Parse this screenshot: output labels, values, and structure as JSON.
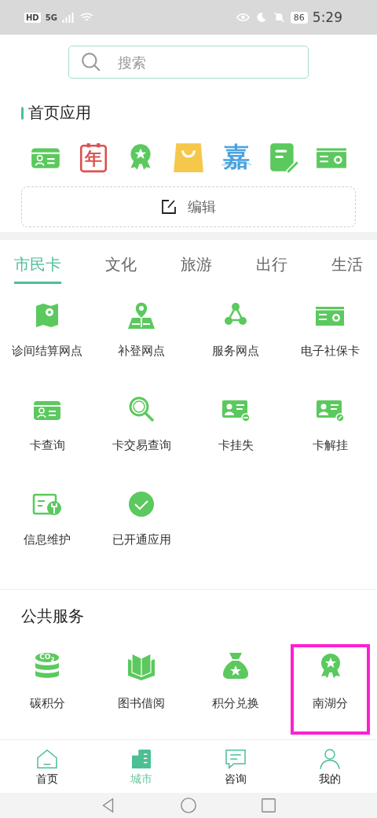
{
  "status_bar": {
    "hd": "HD",
    "network": "5G",
    "battery": "86",
    "time": "5:29"
  },
  "search": {
    "placeholder": "搜索"
  },
  "home_apps": {
    "title": "首页应用",
    "edit_button": "编辑",
    "apps": [
      {
        "kind": "card"
      },
      {
        "kind": "calendar",
        "glyph": "年"
      },
      {
        "kind": "medal"
      },
      {
        "kind": "bag"
      },
      {
        "kind": "character",
        "glyph": "嘉"
      },
      {
        "kind": "note"
      },
      {
        "kind": "socialcard"
      }
    ]
  },
  "tabs": [
    {
      "label": "市民卡",
      "selected": true
    },
    {
      "label": "文化",
      "selected": false
    },
    {
      "label": "旅游",
      "selected": false
    },
    {
      "label": "出行",
      "selected": false
    },
    {
      "label": "生活",
      "selected": false
    }
  ],
  "services": [
    {
      "kind": "map",
      "label": "诊间结算网点"
    },
    {
      "kind": "pinmap",
      "label": "补登网点"
    },
    {
      "kind": "network",
      "label": "服务网点"
    },
    {
      "kind": "socialcard",
      "label": "电子社保卡"
    },
    {
      "kind": "card",
      "label": "卡查询"
    },
    {
      "kind": "magnifier",
      "label": "卡交易查询"
    },
    {
      "kind": "idminus",
      "label": "卡挂失"
    },
    {
      "kind": "idlink",
      "label": "卡解挂"
    },
    {
      "kind": "wrench",
      "label": "信息维护"
    },
    {
      "kind": "check",
      "label": "已开通应用"
    }
  ],
  "public_services": {
    "title": "公共服务",
    "items": [
      {
        "kind": "database",
        "glyph": "CO$_{2}$",
        "label": "碳积分",
        "highlighted": false
      },
      {
        "kind": "book",
        "label": "图书借阅",
        "highlighted": false
      },
      {
        "kind": "moneybag",
        "label": "积分兑换",
        "highlighted": false
      },
      {
        "kind": "medal",
        "label": "南湖分",
        "highlighted": true
      }
    ]
  },
  "bottom_nav": [
    {
      "kind": "home",
      "label": "首页",
      "selected": false
    },
    {
      "kind": "building",
      "label": "城市",
      "selected": true
    },
    {
      "kind": "chat",
      "label": "咨询",
      "selected": false
    },
    {
      "kind": "person",
      "label": "我的",
      "selected": false
    }
  ]
}
